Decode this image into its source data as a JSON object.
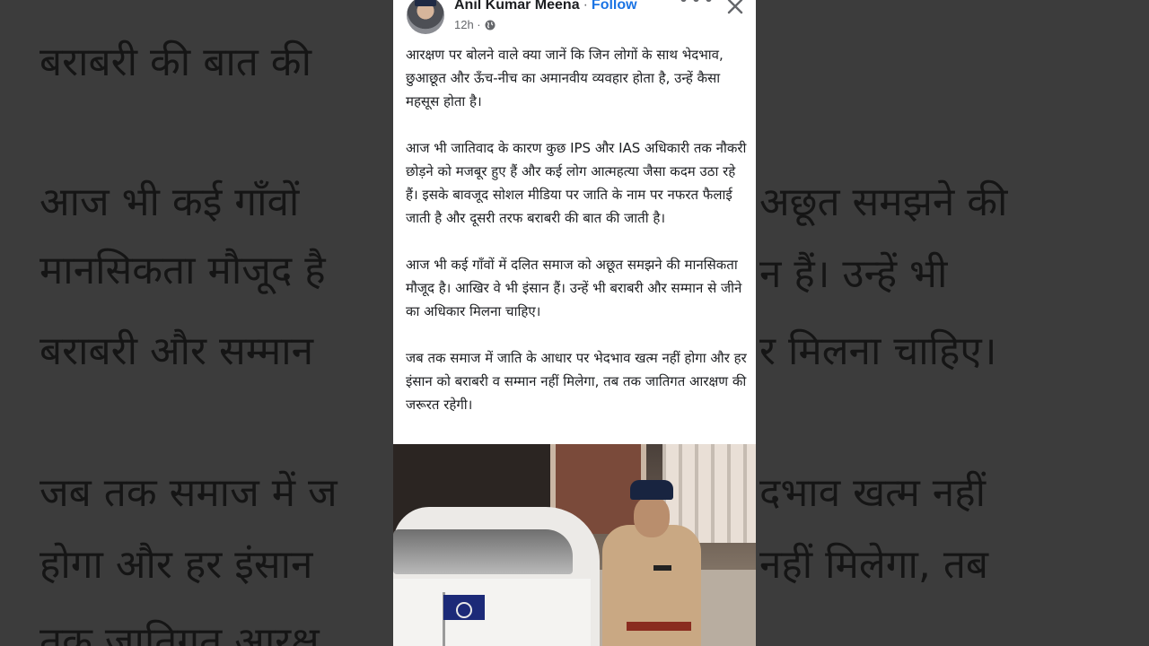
{
  "post": {
    "author": "Anil Kumar Meena",
    "separator": "·",
    "follow_label": "Follow",
    "time": "12h ·",
    "more_label": "•••",
    "paragraphs": [
      "आरक्षण पर बोलने वाले क्या जानें कि जिन लोगों के साथ भेदभाव, छुआछूत और ऊँच-नीच का अमानवीय व्यवहार होता है, उन्हें कैसा महसूस होता है।",
      "आज भी जातिवाद के कारण कुछ IPS और IAS अधिकारी तक नौकरी छोड़ने को मजबूर हुए हैं और कई लोग आत्महत्या जैसा कदम उठा रहे हैं। इसके बावजूद सोशल मीडिया पर जाति के नाम पर नफरत फैलाई जाती है और दूसरी तरफ बराबरी की बात की जाती है।",
      "आज भी कई गाँवों में दलित समाज को अछूत समझने की मानसिकता मौजूद है। आखिर वे भी इंसान हैं। उन्हें भी बराबरी और सम्मान से जीने का अधिकार मिलना चाहिए।",
      "जब तक समाज में जाति के आधार पर भेदभाव खत्म नहीं होगा और हर इंसान को बराबरी व सम्मान नहीं मिलेगा, तब तक जातिगत आरक्षण की जरूरत रहेगी।"
    ],
    "icons": {
      "globe": "globe-icon",
      "close": "close-icon",
      "more": "more-icon"
    },
    "colors": {
      "follow": "#1b74e4",
      "meta": "#65676b",
      "text": "#1c1e21"
    }
  },
  "background": {
    "left_lines": [
      "बराबरी की बात की",
      "आज भी कई गाँवों",
      "मानसिकता मौजूद है",
      "बराबरी और सम्मान",
      "जब तक समाज में ज",
      "होगा और हर इंसान",
      "तक जातिगत आरक्ष"
    ],
    "right_lines": [
      "अछूत समझने की",
      "न हैं। उन्हें भी",
      "र मिलना चाहिए।",
      "दभाव खत्म नहीं",
      "नहीं मिलेगा, तब"
    ]
  }
}
